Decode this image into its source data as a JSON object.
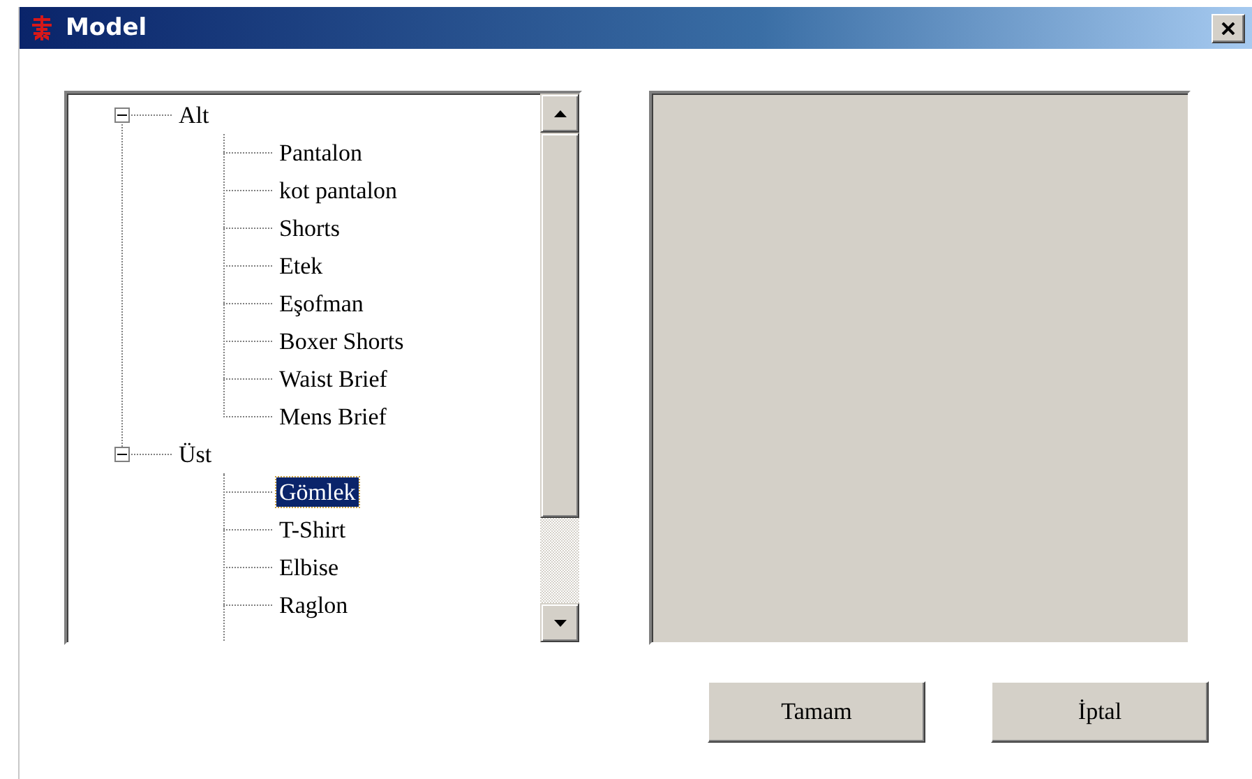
{
  "window": {
    "title": "Model"
  },
  "tree": [
    {
      "label": "Alt",
      "expanded": true,
      "selected": false,
      "children": [
        {
          "label": "Pantalon",
          "selected": false
        },
        {
          "label": "kot pantalon",
          "selected": false
        },
        {
          "label": "Shorts",
          "selected": false
        },
        {
          "label": "Etek",
          "selected": false
        },
        {
          "label": "Eşofman",
          "selected": false
        },
        {
          "label": "Boxer Shorts",
          "selected": false
        },
        {
          "label": "Waist Brief",
          "selected": false
        },
        {
          "label": "Mens Brief",
          "selected": false
        }
      ]
    },
    {
      "label": "Üst",
      "expanded": true,
      "selected": false,
      "children": [
        {
          "label": "Gömlek",
          "selected": true
        },
        {
          "label": "T-Shirt",
          "selected": false
        },
        {
          "label": "Elbise",
          "selected": false
        },
        {
          "label": "Raglon",
          "selected": false
        }
      ]
    }
  ],
  "buttons": [
    "Tamam",
    "İptal"
  ]
}
